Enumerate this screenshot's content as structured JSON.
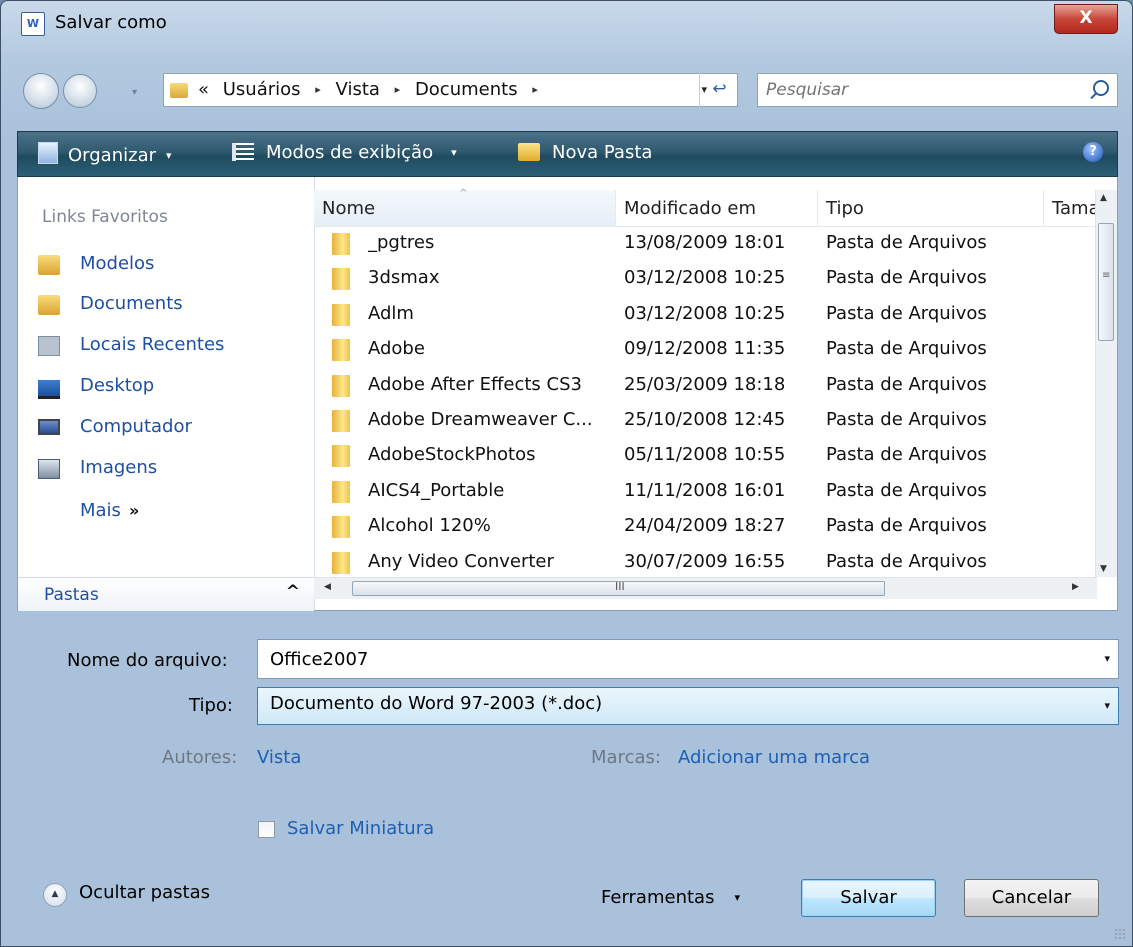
{
  "window": {
    "title": "Salvar como",
    "app_icon_text": "W",
    "close_glyph": "X"
  },
  "address": {
    "prefix": "«",
    "crumbs": [
      "Usuários",
      "Vista",
      "Documents"
    ],
    "separator": "▸",
    "dropdown_glyph": "▾",
    "refresh_glyph": "↩"
  },
  "search": {
    "placeholder": "Pesquisar"
  },
  "toolbar": {
    "organize": "Organizar",
    "views": "Modos de exibição",
    "new_folder": "Nova Pasta",
    "caret": "▾",
    "help": "?"
  },
  "nav": {
    "heading": "Links Favoritos",
    "items": [
      {
        "label": "Modelos",
        "icon": "folder"
      },
      {
        "label": "Documents",
        "icon": "folder"
      },
      {
        "label": "Locais Recentes",
        "icon": "recent"
      },
      {
        "label": "Desktop",
        "icon": "desktop"
      },
      {
        "label": "Computador",
        "icon": "computer"
      },
      {
        "label": "Imagens",
        "icon": "pictures"
      }
    ],
    "more": "Mais",
    "more_glyph": "»",
    "folders": "Pastas",
    "folders_toggle": "^"
  },
  "columns": [
    "Nome",
    "Modificado em",
    "Tipo",
    "Tamanho"
  ],
  "sort_glyph": "^",
  "files": [
    {
      "name": "_pgtres",
      "modified": "13/08/2009 18:01",
      "type": "Pasta de Arquivos"
    },
    {
      "name": "3dsmax",
      "modified": "03/12/2008 10:25",
      "type": "Pasta de Arquivos"
    },
    {
      "name": "Adlm",
      "modified": "03/12/2008 10:25",
      "type": "Pasta de Arquivos"
    },
    {
      "name": "Adobe",
      "modified": "09/12/2008 11:35",
      "type": "Pasta de Arquivos"
    },
    {
      "name": "Adobe After Effects CS3",
      "modified": "25/03/2009 18:18",
      "type": "Pasta de Arquivos"
    },
    {
      "name": "Adobe Dreamweaver C...",
      "modified": "25/10/2008 12:45",
      "type": "Pasta de Arquivos"
    },
    {
      "name": "AdobeStockPhotos",
      "modified": "05/11/2008 10:55",
      "type": "Pasta de Arquivos"
    },
    {
      "name": "AICS4_Portable",
      "modified": "11/11/2008 16:01",
      "type": "Pasta de Arquivos"
    },
    {
      "name": "Alcohol 120%",
      "modified": "24/04/2009 18:27",
      "type": "Pasta de Arquivos"
    },
    {
      "name": "Any Video Converter",
      "modified": "30/07/2009 16:55",
      "type": "Pasta de Arquivos"
    }
  ],
  "scroll": {
    "up": "▲",
    "down": "▼",
    "left": "◀",
    "right": "▶",
    "vgrip": "≡",
    "hgrip": "III"
  },
  "form": {
    "filename_label": "Nome do arquivo:",
    "filename_value": "Office2007",
    "type_label": "Tipo:",
    "type_value": "Documento do Word 97-2003 (*.doc)",
    "dropdown_glyph": "▾",
    "authors_label": "Autores:",
    "authors_value": "Vista",
    "tags_label": "Marcas:",
    "tags_value": "Adicionar uma marca",
    "thumbnail_label": "Salvar Miniatura",
    "thumbnail_checked": false
  },
  "footer": {
    "hide_folders": "Ocultar pastas",
    "hide_glyph": "▲",
    "tools": "Ferramentas",
    "tools_caret": "▾",
    "save": "Salvar",
    "cancel": "Cancelar"
  }
}
